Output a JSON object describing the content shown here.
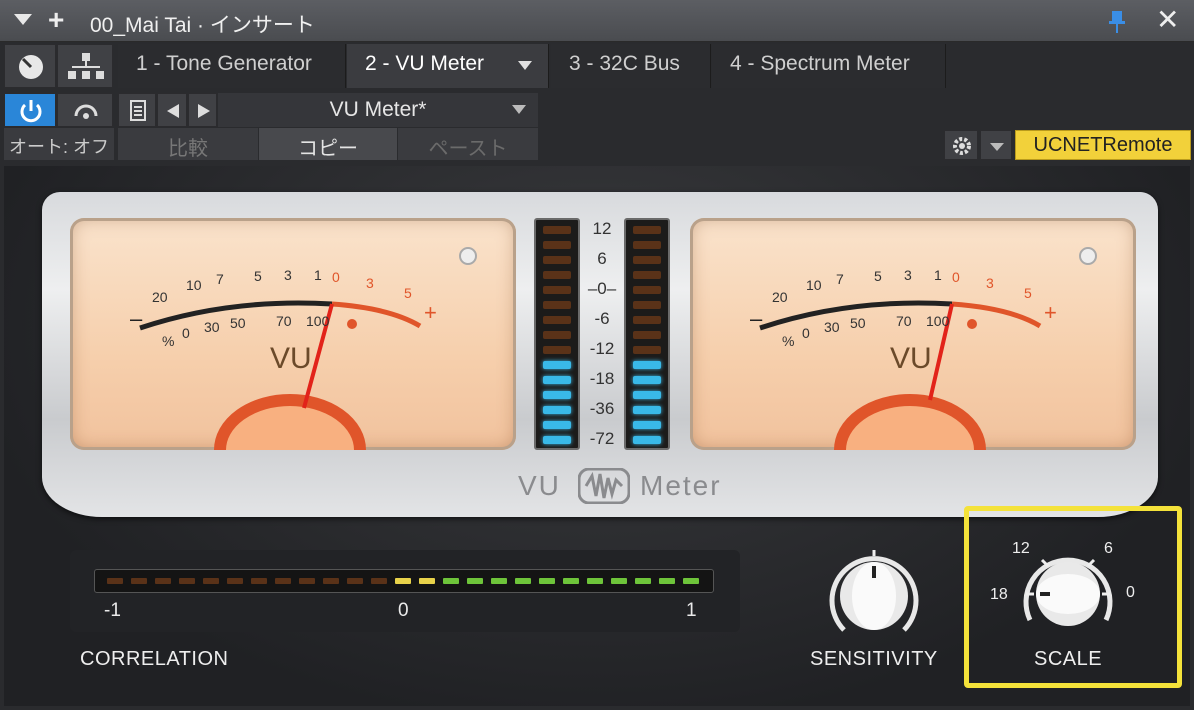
{
  "window": {
    "title": "00_Mai Tai · インサート",
    "add_symbol": "+",
    "close_symbol": "✕"
  },
  "tabs": [
    {
      "label": "1 - Tone Generator"
    },
    {
      "label": "2 - VU Meter"
    },
    {
      "label": "3 - 32C Bus"
    },
    {
      "label": "4 - Spectrum Meter"
    }
  ],
  "toolbar": {
    "preset_name": "VU Meter*",
    "auto_label": "オート: オフ",
    "compare_label": "比較",
    "copy_label": "コピー",
    "paste_label": "ペースト",
    "remote_label": "UCNETRemote"
  },
  "vu": {
    "ticks_black": [
      "20",
      "10",
      "7",
      "5",
      "3",
      "1"
    ],
    "ticks_red": [
      "0",
      "3",
      "5"
    ],
    "ticks_bottom": [
      "%",
      "0",
      "30",
      "50",
      "70",
      "100"
    ],
    "minus": "–",
    "plus": "+",
    "face_label": "VU"
  },
  "led_scale": [
    "12",
    "6",
    "–0–",
    "-6",
    "-12",
    "-18",
    "-36",
    "-72"
  ],
  "brand": {
    "left": "VU",
    "right": "Meter"
  },
  "correlation": {
    "label": "CORRELATION",
    "min": "-1",
    "mid": "0",
    "max": "1"
  },
  "sensitivity": {
    "label": "SENSITIVITY"
  },
  "scale": {
    "label": "SCALE",
    "options": [
      "12",
      "6",
      "18",
      "0"
    ]
  },
  "colors": {
    "accent_blue": "#2a86d8",
    "remote_yellow": "#f2d13a",
    "needle_red": "#e2231a",
    "highlight_yellow": "#f4e23a"
  }
}
